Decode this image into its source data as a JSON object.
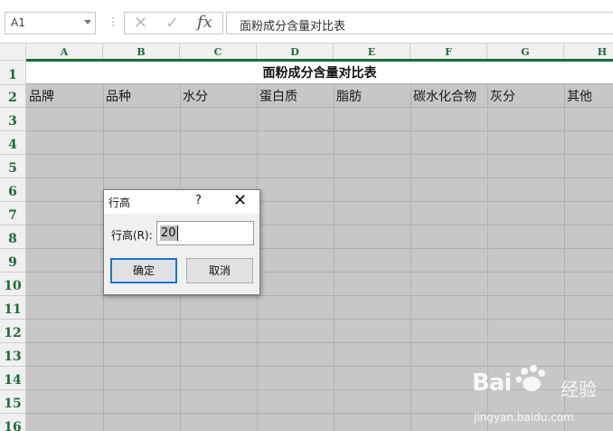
{
  "formula_bar": {
    "name_box": "A1",
    "cancel_icon": "✕",
    "enter_icon": "✓",
    "fx_label": "fx",
    "formula_value": "面粉成分含量对比表"
  },
  "sheet": {
    "columns": [
      "A",
      "B",
      "C",
      "D",
      "E",
      "F",
      "G",
      "H"
    ],
    "rows": [
      "1",
      "2",
      "3",
      "4",
      "5",
      "6",
      "7",
      "8",
      "9",
      "10",
      "11",
      "12",
      "13",
      "14",
      "15",
      "16"
    ],
    "title": "面粉成分含量对比表",
    "header_row": [
      "品牌",
      "品种",
      "水分",
      "蛋白质",
      "脂肪",
      "碳水化合物",
      "灰分",
      "其他"
    ]
  },
  "dialog": {
    "title": "行高",
    "help": "?",
    "close": "✕",
    "label": "行高(R):",
    "value": "20",
    "ok_label": "确定",
    "cancel_label": "取消"
  },
  "watermark": {
    "logo": "Bai",
    "logo_tail": "经验",
    "url": "jingyan.baidu.com"
  },
  "colors": {
    "header_text": "#1d6b39",
    "selection_fill": "#c7c7c7",
    "dialog_ok_border": "#1a73d6"
  }
}
